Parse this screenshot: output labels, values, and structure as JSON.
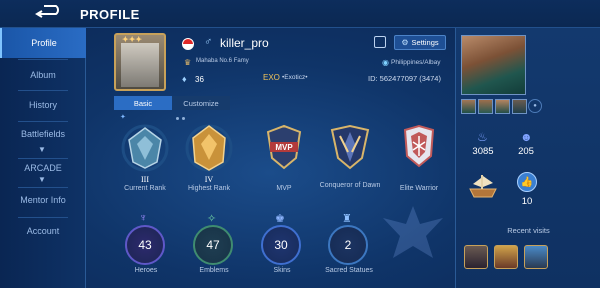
{
  "header": {
    "title": "PROFILE",
    "back_icon": "back-arrow-icon"
  },
  "sidebar": {
    "items": [
      {
        "label": "Profile",
        "active": true
      },
      {
        "label": "Album"
      },
      {
        "label": "History"
      },
      {
        "label": "Battlefields",
        "expandable": true
      },
      {
        "label": "ARCADE",
        "expandable": true
      },
      {
        "label": "Mentor Info"
      },
      {
        "label": "Account"
      }
    ]
  },
  "profile": {
    "name": "killer_pro",
    "gender_symbol": "♂",
    "badge_text": "Mahaba No.6 Famy",
    "level": "36",
    "squad_tag": "EXO",
    "squad_name": "•Exoticz•",
    "location": "Philippines/Albay",
    "id": "ID:  562477097 (3474)",
    "settings_label": "Settings",
    "flag_colors": [
      "#e02828",
      "#ffffff"
    ]
  },
  "tabs": [
    {
      "label": "Basic",
      "active": true
    },
    {
      "label": "Customize"
    }
  ],
  "achievements": [
    {
      "label": "Current Rank",
      "roman": "III",
      "icon": "mythic-rank-icon",
      "color": "#4b86a8"
    },
    {
      "label": "Highest Rank",
      "roman": "IV",
      "icon": "legend-rank-icon",
      "color": "#c9923a"
    },
    {
      "label": "MVP",
      "roman": "",
      "icon": "mvp-icon",
      "color": "#b33b3b"
    },
    {
      "label": "Conqueror of Dawn",
      "roman": "",
      "icon": "conqueror-icon",
      "color": "#5b74b8"
    },
    {
      "label": "Elite Warrior",
      "roman": "",
      "icon": "elite-warrior-icon",
      "color": "#c15a5a"
    }
  ],
  "stats": [
    {
      "label": "Heroes",
      "value": "43",
      "icon": "heroes-icon",
      "color": "#7a6be0"
    },
    {
      "label": "Emblems",
      "value": "47",
      "icon": "emblems-icon",
      "color": "#4fa27a"
    },
    {
      "label": "Skins",
      "value": "30",
      "icon": "skins-icon",
      "color": "#3f6fd0"
    },
    {
      "label": "Sacred Statues",
      "value": "2",
      "icon": "sacred-statue-icon",
      "color": "#3c77c0"
    }
  ],
  "right_panel": {
    "popularity": "3085",
    "followers": "205",
    "likes": "10",
    "recent_visits_label": "Recent visits"
  }
}
